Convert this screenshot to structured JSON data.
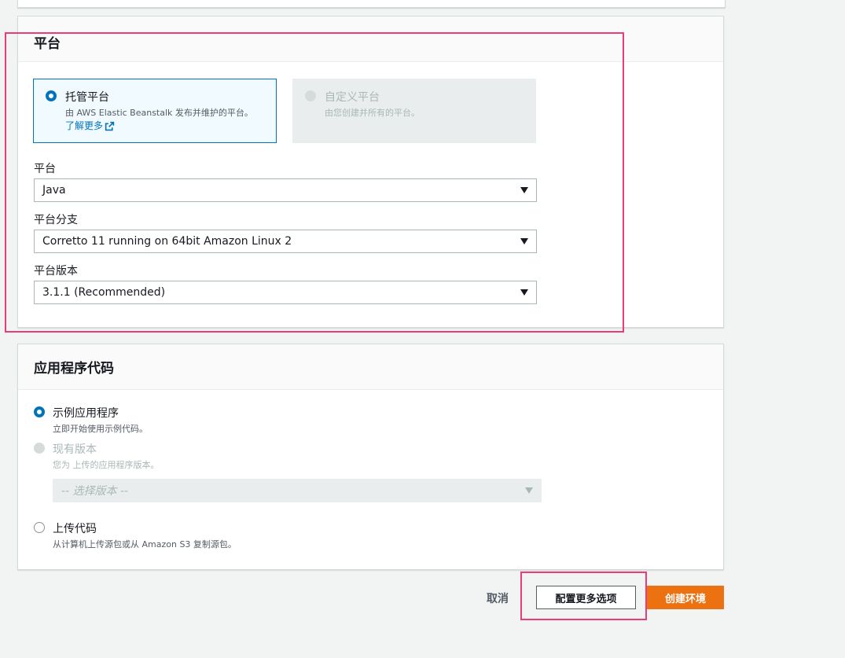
{
  "platform_section": {
    "title": "平台",
    "platform_type": {
      "managed": {
        "label": "托管平台",
        "description": "由 AWS Elastic Beanstalk 发布并维护的平台。",
        "link": "了解更多",
        "selected": true
      },
      "custom": {
        "label": "自定义平台",
        "description": "由您创建并所有的平台。",
        "disabled": true
      }
    },
    "platform": {
      "label": "平台",
      "value": "Java"
    },
    "branch": {
      "label": "平台分支",
      "value": "Corretto 11 running on 64bit Amazon Linux 2"
    },
    "version": {
      "label": "平台版本",
      "value": "3.1.1 (Recommended)"
    }
  },
  "code_section": {
    "title": "应用程序代码",
    "options": [
      {
        "label": "示例应用程序",
        "description": "立即开始使用示例代码。",
        "state": "selected"
      },
      {
        "label": "现有版本",
        "description": "您为 上传的应用程序版本。",
        "state": "disabled"
      },
      {
        "label": "上传代码",
        "description": "从计算机上传源包或从 Amazon S3 复制源包。",
        "state": "unselected"
      }
    ],
    "version_select_placeholder": "-- 选择版本 --"
  },
  "actions": {
    "cancel": "取消",
    "configure_more": "配置更多选项",
    "create": "创建环境"
  },
  "colors": {
    "accent": "#0073bb",
    "primary_button": "#ec7211",
    "highlight": "#ec3b7a",
    "background": "#f2f3f3"
  },
  "icons": {
    "external_link": "external-link-icon",
    "dropdown": "caret-down-icon"
  }
}
